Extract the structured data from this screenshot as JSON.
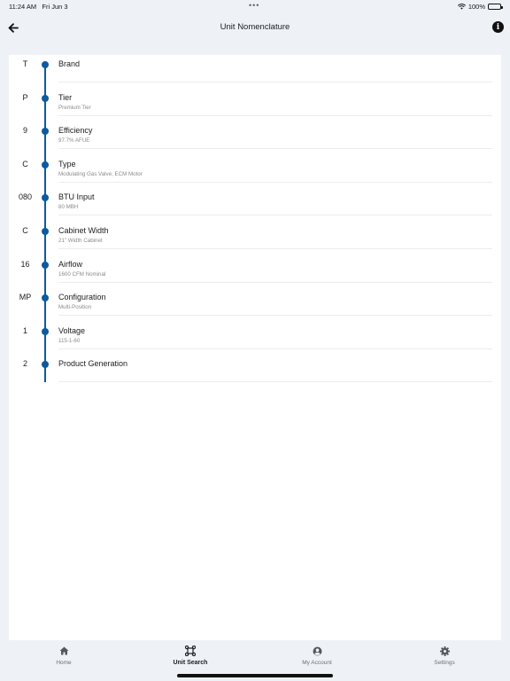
{
  "status": {
    "time": "11:24 AM",
    "date": "Fri Jun 3",
    "battery": "100%",
    "multitask_dots": "•••"
  },
  "nav": {
    "title": "Unit Nomenclature"
  },
  "items": [
    {
      "code": "T",
      "label": "Brand",
      "sub": ""
    },
    {
      "code": "P",
      "label": "Tier",
      "sub": "Premium Tier"
    },
    {
      "code": "9",
      "label": "Efficiency",
      "sub": "97.7% AFUE"
    },
    {
      "code": "C",
      "label": "Type",
      "sub": "Modulating Gas Valve, ECM Motor"
    },
    {
      "code": "080",
      "label": "BTU Input",
      "sub": "80 MBH"
    },
    {
      "code": "C",
      "label": "Cabinet Width",
      "sub": "21\" Width Cabinet"
    },
    {
      "code": "16",
      "label": "Airflow",
      "sub": "1600 CFM Nominal"
    },
    {
      "code": "MP",
      "label": "Configuration",
      "sub": "Multi-Position"
    },
    {
      "code": "1",
      "label": "Voltage",
      "sub": "115-1-60"
    },
    {
      "code": "2",
      "label": "Product Generation",
      "sub": ""
    }
  ],
  "tabs": [
    {
      "label": "Home",
      "icon": "home-icon"
    },
    {
      "label": "Unit Search",
      "icon": "unit-search-icon"
    },
    {
      "label": "My Account",
      "icon": "account-icon"
    },
    {
      "label": "Settings",
      "icon": "gear-icon"
    }
  ],
  "active_tab": "Unit Search",
  "colors": {
    "accent": "#0d5aa0",
    "background": "#eef2f6",
    "card": "#ffffff"
  }
}
